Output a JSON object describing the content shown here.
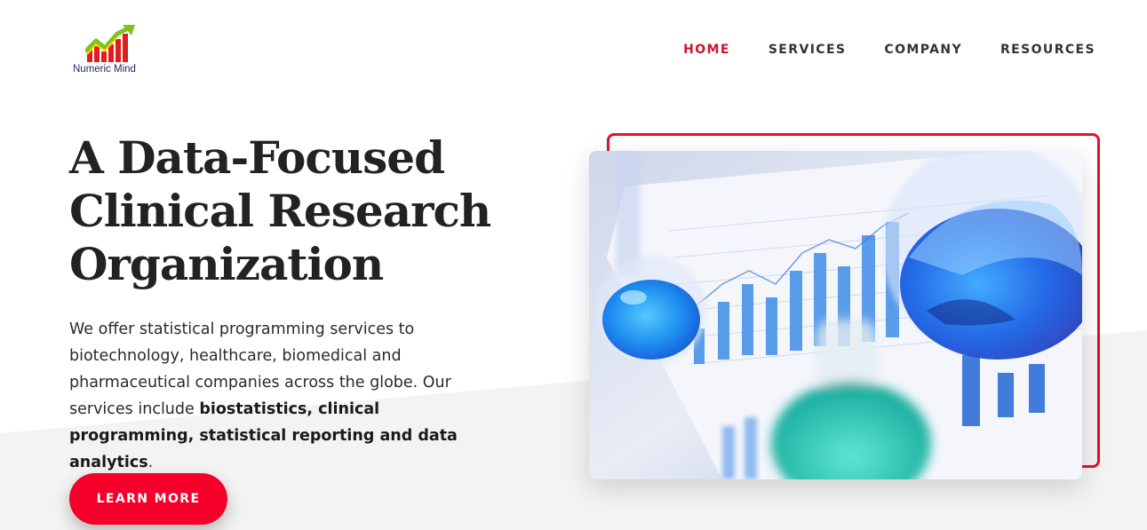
{
  "brand": {
    "name": "Numeric Mind",
    "logo_icon": "rising-chart-arrow-icon"
  },
  "nav": {
    "items": [
      {
        "label": "HOME",
        "active": true
      },
      {
        "label": "SERVICES",
        "active": false
      },
      {
        "label": "COMPANY",
        "active": false
      },
      {
        "label": "RESOURCES",
        "active": false
      }
    ]
  },
  "hero": {
    "title_lines": [
      "A Data-Focused",
      "Clinical Research",
      "Organization"
    ],
    "description_start": "We offer statistical programming services to biotechnology, healthcare, biomedical and pharmaceutical companies across the globe. Our services include ",
    "description_bold": "biostatistics, clinical programming, statistical reporting and data analytics",
    "description_end": ".",
    "cta_label": "LEARN MORE",
    "image_alt": "Laboratory flasks with blue liquid over a printed bar chart report"
  },
  "colors": {
    "accent": "#f5002a",
    "nav_active": "#d6112f",
    "frame": "#e4112e",
    "heading": "#222222"
  }
}
